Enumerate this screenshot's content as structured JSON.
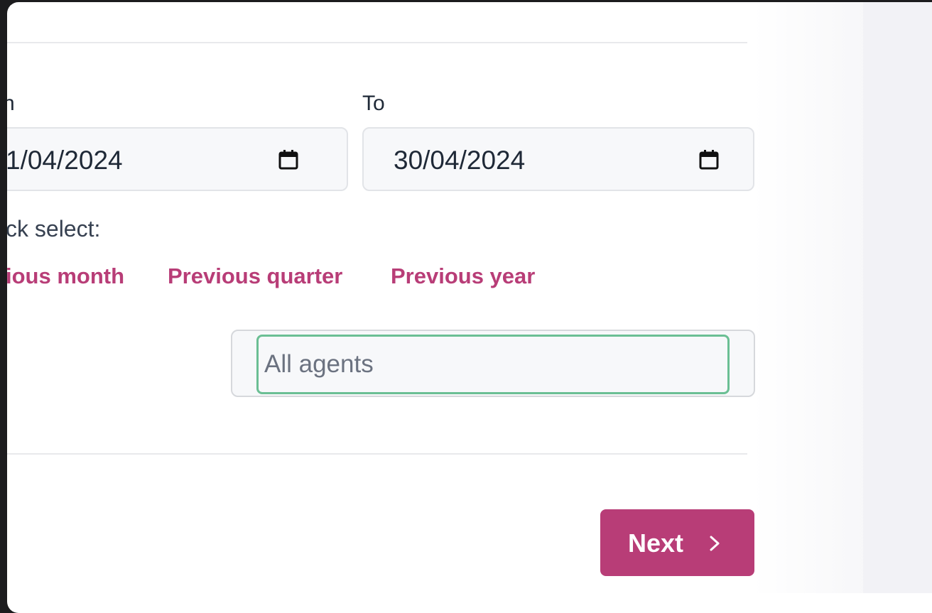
{
  "form": {
    "from_label_fragment": "n",
    "from_date_fragment": "1/04/2024",
    "to_label": "To",
    "to_date": "30/04/2024",
    "quick_select_fragment": "ck select:",
    "quick_links": [
      {
        "label": "ious month"
      },
      {
        "label": "Previous quarter"
      },
      {
        "label": "Previous year"
      }
    ],
    "agents_placeholder": "All agents",
    "agents_value": ""
  },
  "footer": {
    "next_label": "Next",
    "next_icon": "chevron-right-icon"
  },
  "colors": {
    "accent": "#b83d77",
    "focus_ring": "#6bbf94",
    "field_bg": "#f7f8fa",
    "side_panel": "#f2f2f6"
  }
}
